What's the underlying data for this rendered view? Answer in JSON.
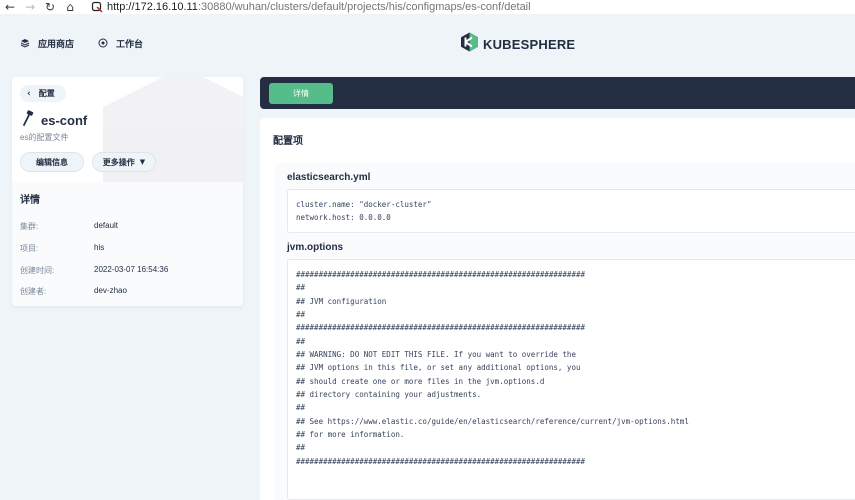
{
  "browser": {
    "url_host": "http://172.16.10.11",
    "url_rest": ":30880/wuhan/clusters/default/projects/his/configmaps/es-conf/detail",
    "back_glyph": "←",
    "forward_glyph": "→",
    "reload_glyph": "↻",
    "home_glyph": "⌂"
  },
  "topnav": {
    "app_store_label": "应用商店",
    "workbench_label": "工作台",
    "logo_text": "KUBESPHERE",
    "brand_color": "#55bc8a"
  },
  "resource": {
    "back_label": "配置",
    "name": "es-conf",
    "description": "es的配置文件",
    "edit_button": "编辑信息",
    "more_button": "更多操作",
    "details_title": "详情",
    "details": [
      {
        "label": "集群:",
        "value": "default"
      },
      {
        "label": "项目:",
        "value": "his"
      },
      {
        "label": "创建时间:",
        "value": "2022-03-07 16:54:36"
      },
      {
        "label": "创建者:",
        "value": "dev-zhao"
      }
    ]
  },
  "tabs": {
    "active": "详情"
  },
  "config": {
    "section_title": "配置项",
    "entries": [
      {
        "key": "elasticsearch.yml",
        "lines": [
          "cluster.name: \"docker-cluster\"",
          "network.host: 0.0.0.0"
        ]
      },
      {
        "key": "jvm.options",
        "lines": [
          "################################################################",
          "##",
          "## JVM configuration",
          "##",
          "################################################################",
          "##",
          "## WARNING: DO NOT EDIT THIS FILE. If you want to override the",
          "## JVM options in this file, or set any additional options, you",
          "## should create one or more files in the jvm.options.d",
          "## directory containing your adjustments.",
          "##",
          "## See https://www.elastic.co/guide/en/elasticsearch/reference/current/jvm-options.html",
          "## for more information.",
          "##",
          "################################################################"
        ]
      }
    ]
  },
  "colors": {
    "tabbar": "#242e42",
    "accent": "#55bc8a",
    "page_bg": "#eff4f9"
  }
}
